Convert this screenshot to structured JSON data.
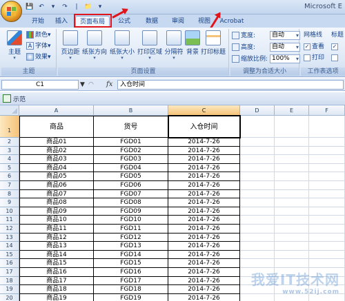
{
  "app": {
    "title": "Microsoft E"
  },
  "tabs": [
    {
      "label": "开始"
    },
    {
      "label": "插入"
    },
    {
      "label": "页面布局",
      "active": true
    },
    {
      "label": "公式"
    },
    {
      "label": "数据"
    },
    {
      "label": "审阅"
    },
    {
      "label": "视图"
    },
    {
      "label": "Acrobat"
    }
  ],
  "ribbon": {
    "theme_group": {
      "label": "主题",
      "theme_button": "主题",
      "colors": "颜色",
      "fonts": "字体",
      "effects": "效果"
    },
    "page_setup_group": {
      "label": "页面设置",
      "buttons": [
        "页边距",
        "纸张方向",
        "纸张大小",
        "打印区域",
        "分隔符",
        "背景",
        "打印标题"
      ]
    },
    "scale_group": {
      "label": "调整为合适大小",
      "width_label": "宽度:",
      "width_value": "自动",
      "height_label": "高度:",
      "height_value": "自动",
      "scale_label": "缩放比例:",
      "scale_value": "100%"
    },
    "sheet_options_group": {
      "label": "工作表选项",
      "gridlines": "网格线",
      "headings": "标题",
      "view": "查看",
      "print": "打印"
    }
  },
  "formula_bar": {
    "name_box": "C1",
    "fx": "fx",
    "content": "入仓时间"
  },
  "workbook": {
    "name": "示范"
  },
  "sheet": {
    "columns": [
      "A",
      "B",
      "C",
      "D",
      "E",
      "F"
    ],
    "selected_column": "C",
    "headers": [
      "商品",
      "货号",
      "入仓时间"
    ],
    "rows": [
      [
        "1",
        "商品",
        "货号",
        "入仓时间"
      ],
      [
        "2",
        "商品01",
        "FGD01",
        "2014-7-26"
      ],
      [
        "3",
        "商品02",
        "FGD02",
        "2014-7-26"
      ],
      [
        "4",
        "商品03",
        "FGD03",
        "2014-7-26"
      ],
      [
        "5",
        "商品04",
        "FGD04",
        "2014-7-26"
      ],
      [
        "6",
        "商品05",
        "FGD05",
        "2014-7-26"
      ],
      [
        "7",
        "商品06",
        "FGD06",
        "2014-7-26"
      ],
      [
        "8",
        "商品07",
        "FGD07",
        "2014-7-26"
      ],
      [
        "9",
        "商品08",
        "FGD08",
        "2014-7-26"
      ],
      [
        "10",
        "商品09",
        "FGD09",
        "2014-7-26"
      ],
      [
        "11",
        "商品10",
        "FGD10",
        "2014-7-26"
      ],
      [
        "12",
        "商品11",
        "FGD11",
        "2014-7-26"
      ],
      [
        "13",
        "商品12",
        "FGD12",
        "2014-7-26"
      ],
      [
        "14",
        "商品13",
        "FGD13",
        "2014-7-26"
      ],
      [
        "15",
        "商品14",
        "FGD14",
        "2014-7-26"
      ],
      [
        "16",
        "商品15",
        "FGD15",
        "2014-7-26"
      ],
      [
        "17",
        "商品16",
        "FGD16",
        "2014-7-26"
      ],
      [
        "18",
        "商品17",
        "FGD17",
        "2014-7-26"
      ],
      [
        "19",
        "商品18",
        "FGD18",
        "2014-7-26"
      ],
      [
        "20",
        "商品19",
        "FGD19",
        "2014-7-26"
      ]
    ]
  },
  "watermark": {
    "text": "我爱IT技术网",
    "url": "www.52ij.com"
  },
  "colors": {
    "highlight_red": "#e0151b",
    "ribbon_blue": "#15428b"
  }
}
